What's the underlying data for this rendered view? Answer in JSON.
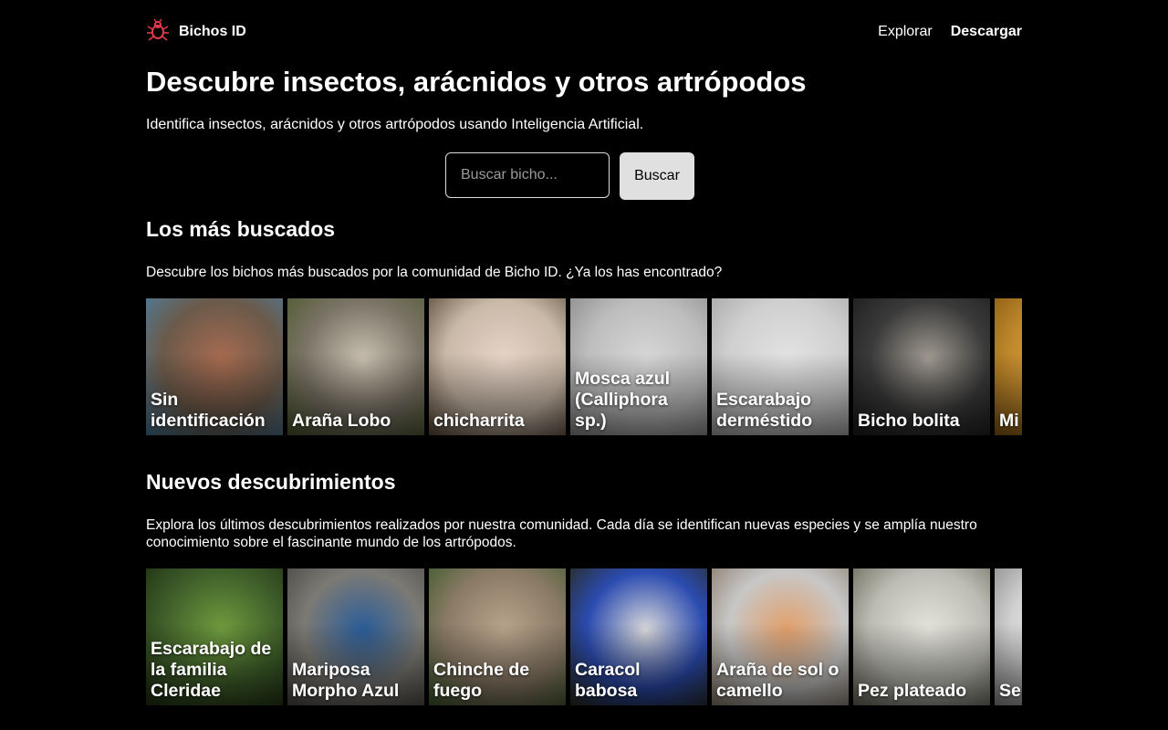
{
  "header": {
    "brand": "Bichos ID",
    "logo_icon": "bug-icon",
    "nav": [
      {
        "label": "Explorar"
      },
      {
        "label": "Descargar"
      }
    ]
  },
  "hero": {
    "title": "Descubre insectos, arácnidos y otros artrópodos",
    "subtitle": "Identifica insectos, arácnidos y otros artrópodos usando Inteligencia Artificial.",
    "search_placeholder": "Buscar bicho...",
    "search_button": "Buscar"
  },
  "popular": {
    "title": "Los más buscados",
    "description": "Descubre los bichos más buscados por la comunidad de Bicho ID. ¿Ya los has encontrado?",
    "cards": [
      {
        "label": "Sin identificación",
        "colors": [
          "#6b5a4a",
          "#a86b50",
          "#4b7e9e"
        ]
      },
      {
        "label": "Araña Lobo",
        "colors": [
          "#7a7366",
          "#c9c0b0",
          "#4c5a2c"
        ]
      },
      {
        "label": "chicharrita",
        "colors": [
          "#c9b9a8",
          "#e7d5c8",
          "#5a4a3a"
        ]
      },
      {
        "label": "Mosca azul (Calliphora sp.)",
        "colors": [
          "#bdbdbd",
          "#d7d7d7",
          "#8a8a8a"
        ]
      },
      {
        "label": "Escarabajo derméstido",
        "colors": [
          "#cfcfcf",
          "#e3e3e3",
          "#a6a6a6"
        ]
      },
      {
        "label": "Bicho bolita",
        "colors": [
          "#3a3a3a",
          "#a19b92",
          "#1c1c1c"
        ]
      },
      {
        "label": "Mi",
        "colors": [
          "#c18a2c",
          "#e0a640",
          "#8a5c14"
        ]
      }
    ]
  },
  "new": {
    "title": "Nuevos descubrimientos",
    "description": "Explora los últimos descubrimientos realizados por nuestra comunidad. Cada día se identifican nuevas especies y se amplía nuestro conocimiento sobre el fascinante mundo de los artrópodos.",
    "cards": [
      {
        "label": "Escarabajo de la familia Cleridae",
        "colors": [
          "#3f5f2a",
          "#6f9c3e",
          "#1f2f12"
        ]
      },
      {
        "label": "Mariposa Morpho Azul",
        "colors": [
          "#7c7a74",
          "#2a5d9a",
          "#4a4844"
        ]
      },
      {
        "label": "Chinche de fuego",
        "colors": [
          "#8a7a66",
          "#b9a58c",
          "#3d5a2c"
        ]
      },
      {
        "label": "Caracol babosa",
        "colors": [
          "#2b4bb0",
          "#d9d9d9",
          "#2a2a1a"
        ]
      },
      {
        "label": "Araña de sol o camello",
        "colors": [
          "#c7c7c7",
          "#e3a06a",
          "#8a7a6a"
        ]
      },
      {
        "label": "Pez plateado",
        "colors": [
          "#bcbcb4",
          "#e4e4dc",
          "#6a6a5a"
        ]
      },
      {
        "label": "Se Co",
        "colors": [
          "#d2d2d2",
          "#ececec",
          "#8c8c8c"
        ]
      }
    ]
  }
}
